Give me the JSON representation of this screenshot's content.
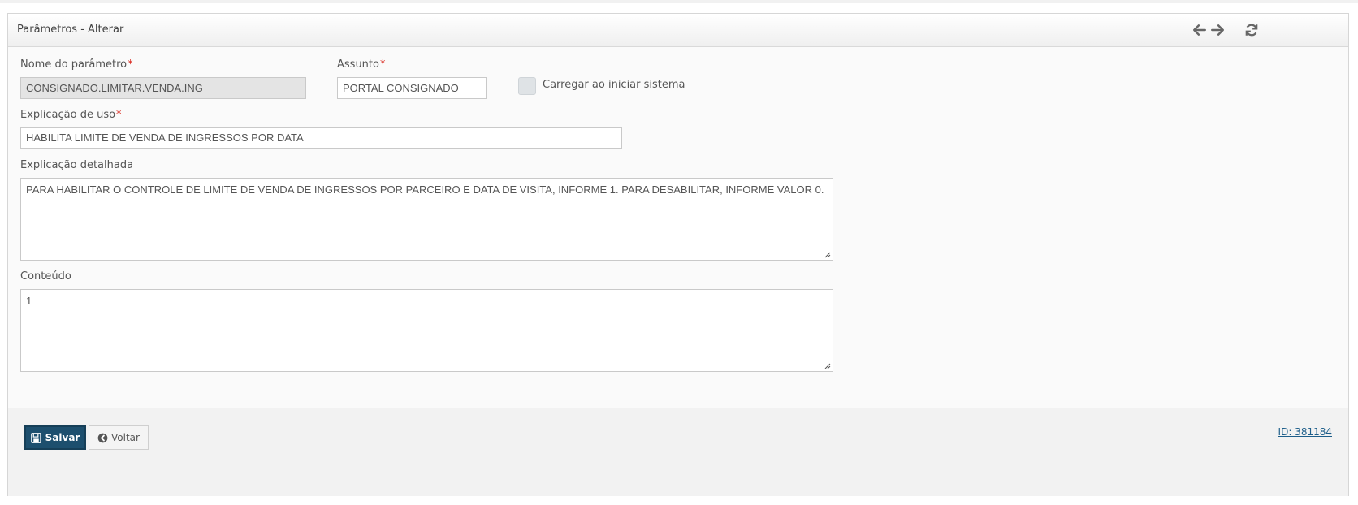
{
  "panel": {
    "title": "Parâmetros - Alterar",
    "icons": [
      "arrow-left-icon",
      "arrow-right-icon",
      "refresh-icon"
    ]
  },
  "form": {
    "nome": {
      "label": "Nome do parâmetro",
      "value": "CONSIGNADO.LIMITAR.VENDA.ING",
      "required_mark": "*"
    },
    "assunto": {
      "label": "Assunto",
      "value": "PORTAL CONSIGNADO",
      "required_mark": "*"
    },
    "carregar": {
      "label": "Carregar ao iniciar sistema",
      "checked": false
    },
    "explicacao": {
      "label": "Explicação de uso",
      "value": "HABILITA LIMITE DE VENDA DE INGRESSOS POR DATA",
      "required_mark": "*"
    },
    "detalhada": {
      "label": "Explicação detalhada",
      "value": "PARA HABILITAR O CONTROLE DE LIMITE DE VENDA DE INGRESSOS POR PARCEIRO E DATA DE VISITA, INFORME 1. PARA DESABILITAR, INFORME VALOR 0."
    },
    "conteudo": {
      "label": "Conteúdo",
      "value": "1"
    }
  },
  "footer": {
    "save_label": "Salvar",
    "back_label": "Voltar",
    "id_text": "ID: 381184"
  },
  "colors": {
    "primary": "#1d4f6e",
    "required": "#d9261c",
    "link": "#1d5e8a"
  }
}
